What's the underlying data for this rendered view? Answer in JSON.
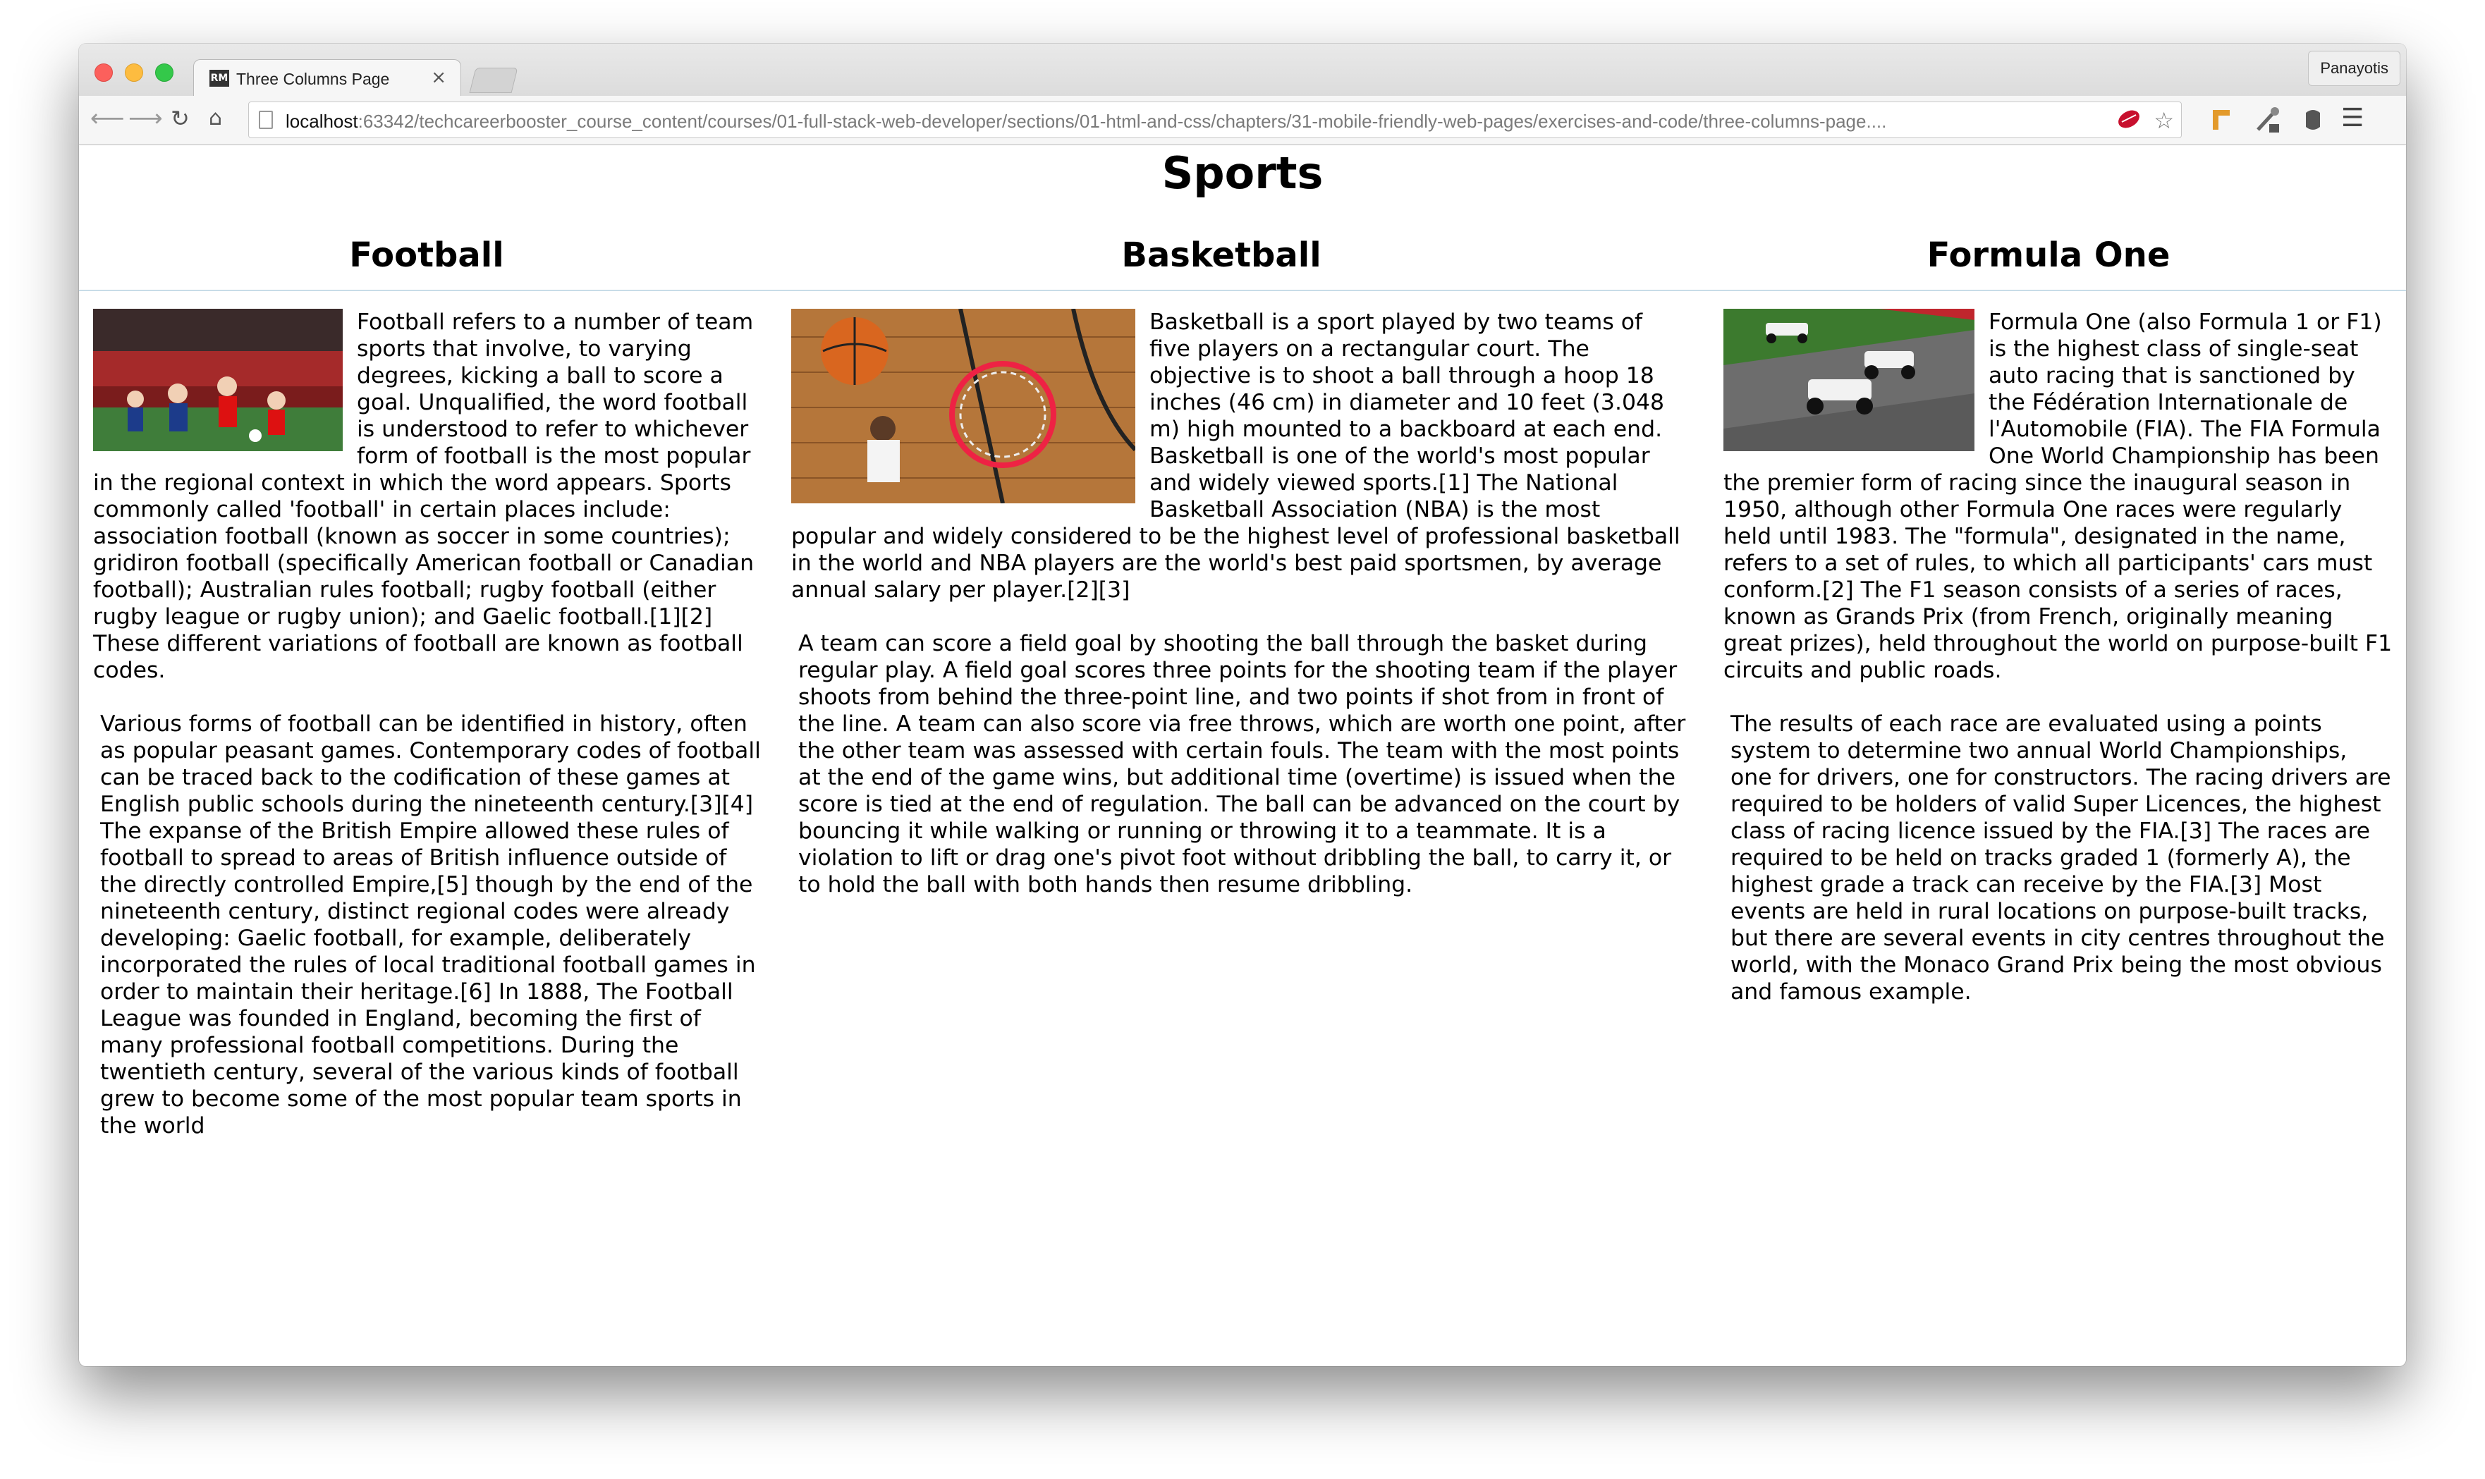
{
  "browser": {
    "tab_title": "Three Columns Page",
    "tab_favicon": "RM",
    "tab_close": "×",
    "profile_label": "Panayotis",
    "url_host": "localhost",
    "url_rest": ":63342/techcareerbooster_course_content/courses/01-full-stack-web-developer/sections/01-html-and-css/chapters/31-mobile-friendly-web-pages/exercises-and-code/three-columns-page...."
  },
  "page": {
    "title": "Sports",
    "columns": [
      {
        "heading": "Football",
        "paragraphs": [
          "Football refers to a number of team sports that involve, to varying degrees, kicking a ball to score a goal. Unqualified, the word football is understood to refer to whichever form of football is the most popular in the regional context in which the word appears. Sports commonly called 'football' in certain places include: association football (known as soccer in some countries); gridiron football (specifically American football or Canadian football); Australian rules football; rugby football (either rugby league or rugby union); and Gaelic football.[1][2] These different variations of football are known as football codes.",
          "Various forms of football can be identified in history, often as popular peasant games. Contemporary codes of football can be traced back to the codification of these games at English public schools during the nineteenth century.[3][4] The expanse of the British Empire allowed these rules of football to spread to areas of British influence outside of the directly controlled Empire,[5] though by the end of the nineteenth century, distinct regional codes were already developing: Gaelic football, for example, deliberately incorporated the rules of local traditional football games in order to maintain their heritage.[6] In 1888, The Football League was founded in England, becoming the first of many professional football competitions. During the twentieth century, several of the various kinds of football grew to become some of the most popular team sports in the world"
        ]
      },
      {
        "heading": "Basketball",
        "paragraphs": [
          "Basketball is a sport played by two teams of five players on a rectangular court. The objective is to shoot a ball through a hoop 18 inches (46 cm) in diameter and 10 feet (3.048 m) high mounted to a backboard at each end. Basketball is one of the world's most popular and widely viewed sports.[1] The National Basketball Association (NBA) is the most popular and widely considered to be the highest level of professional basketball in the world and NBA players are the world's best paid sportsmen, by average annual salary per player.[2][3]",
          "A team can score a field goal by shooting the ball through the basket during regular play. A field goal scores three points for the shooting team if the player shoots from behind the three-point line, and two points if shot from in front of the line. A team can also score via free throws, which are worth one point, after the other team was assessed with certain fouls. The team with the most points at the end of the game wins, but additional time (overtime) is issued when the score is tied at the end of regulation. The ball can be advanced on the court by bouncing it while walking or running or throwing it to a teammate. It is a violation to lift or drag one's pivot foot without dribbling the ball, to carry it, or to hold the ball with both hands then resume dribbling."
        ]
      },
      {
        "heading": "Formula One",
        "paragraphs": [
          "Formula One (also Formula 1 or F1) is the highest class of single-seat auto racing that is sanctioned by the Fédération Internationale de l'Automobile (FIA). The FIA Formula One World Championship has been the premier form of racing since the inaugural season in 1950, although other Formula One races were regularly held until 1983. The \"formula\", designated in the name, refers to a set of rules, to which all participants' cars must conform.[2] The F1 season consists of a series of races, known as Grands Prix (from French, originally meaning great prizes), held throughout the world on purpose-built F1 circuits and public roads.",
          "The results of each race are evaluated using a points system to determine two annual World Championships, one for drivers, one for constructors. The racing drivers are required to be holders of valid Super Licences, the highest class of racing licence issued by the FIA.[3] The races are required to be held on tracks graded 1 (formerly A), the highest grade a track can receive by the FIA.[3] Most events are held in rural locations on purpose-built tracks, but there are several events in city centres throughout the world, with the Monaco Grand Prix being the most obvious and famous example."
        ]
      }
    ]
  }
}
